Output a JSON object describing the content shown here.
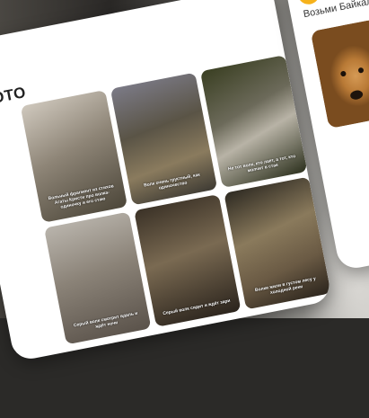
{
  "main_card": {
    "title": "ФОТО",
    "photos": [
      {
        "caption": "Вольный фрагмент из стихов Агаты Кристи про волка-одиночку и его стаю"
      },
      {
        "caption": "Волк очень грустный, как одиночество"
      },
      {
        "caption": "Не тот волк, кто лает, а тот, кто молчит в стае"
      },
      {
        "caption": "Серый волк смотрит вдаль и ждёт ночи"
      },
      {
        "caption": "Серый волк сидит и ждёт зари"
      },
      {
        "caption": "Волки жили в густом лесу у холодной реки"
      }
    ]
  },
  "side_card": {
    "title": "Возьми Байкала и по"
  }
}
